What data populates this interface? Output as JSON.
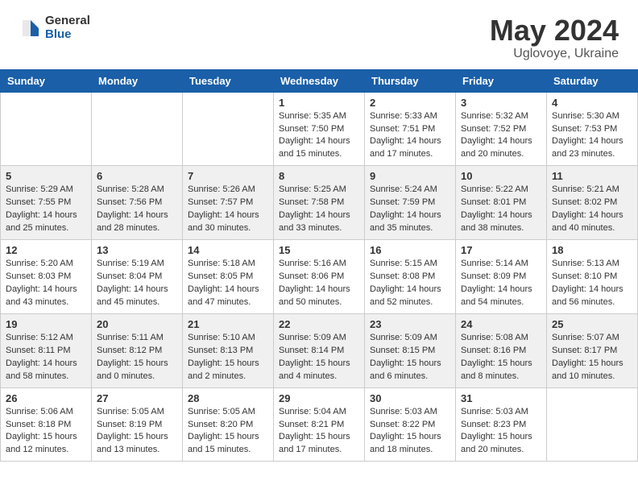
{
  "header": {
    "logo_general": "General",
    "logo_blue": "Blue",
    "month_year": "May 2024",
    "location": "Uglovoye, Ukraine"
  },
  "days_of_week": [
    "Sunday",
    "Monday",
    "Tuesday",
    "Wednesday",
    "Thursday",
    "Friday",
    "Saturday"
  ],
  "weeks": [
    [
      {
        "day": "",
        "info": ""
      },
      {
        "day": "",
        "info": ""
      },
      {
        "day": "",
        "info": ""
      },
      {
        "day": "1",
        "info": "Sunrise: 5:35 AM\nSunset: 7:50 PM\nDaylight: 14 hours\nand 15 minutes."
      },
      {
        "day": "2",
        "info": "Sunrise: 5:33 AM\nSunset: 7:51 PM\nDaylight: 14 hours\nand 17 minutes."
      },
      {
        "day": "3",
        "info": "Sunrise: 5:32 AM\nSunset: 7:52 PM\nDaylight: 14 hours\nand 20 minutes."
      },
      {
        "day": "4",
        "info": "Sunrise: 5:30 AM\nSunset: 7:53 PM\nDaylight: 14 hours\nand 23 minutes."
      }
    ],
    [
      {
        "day": "5",
        "info": "Sunrise: 5:29 AM\nSunset: 7:55 PM\nDaylight: 14 hours\nand 25 minutes."
      },
      {
        "day": "6",
        "info": "Sunrise: 5:28 AM\nSunset: 7:56 PM\nDaylight: 14 hours\nand 28 minutes."
      },
      {
        "day": "7",
        "info": "Sunrise: 5:26 AM\nSunset: 7:57 PM\nDaylight: 14 hours\nand 30 minutes."
      },
      {
        "day": "8",
        "info": "Sunrise: 5:25 AM\nSunset: 7:58 PM\nDaylight: 14 hours\nand 33 minutes."
      },
      {
        "day": "9",
        "info": "Sunrise: 5:24 AM\nSunset: 7:59 PM\nDaylight: 14 hours\nand 35 minutes."
      },
      {
        "day": "10",
        "info": "Sunrise: 5:22 AM\nSunset: 8:01 PM\nDaylight: 14 hours\nand 38 minutes."
      },
      {
        "day": "11",
        "info": "Sunrise: 5:21 AM\nSunset: 8:02 PM\nDaylight: 14 hours\nand 40 minutes."
      }
    ],
    [
      {
        "day": "12",
        "info": "Sunrise: 5:20 AM\nSunset: 8:03 PM\nDaylight: 14 hours\nand 43 minutes."
      },
      {
        "day": "13",
        "info": "Sunrise: 5:19 AM\nSunset: 8:04 PM\nDaylight: 14 hours\nand 45 minutes."
      },
      {
        "day": "14",
        "info": "Sunrise: 5:18 AM\nSunset: 8:05 PM\nDaylight: 14 hours\nand 47 minutes."
      },
      {
        "day": "15",
        "info": "Sunrise: 5:16 AM\nSunset: 8:06 PM\nDaylight: 14 hours\nand 50 minutes."
      },
      {
        "day": "16",
        "info": "Sunrise: 5:15 AM\nSunset: 8:08 PM\nDaylight: 14 hours\nand 52 minutes."
      },
      {
        "day": "17",
        "info": "Sunrise: 5:14 AM\nSunset: 8:09 PM\nDaylight: 14 hours\nand 54 minutes."
      },
      {
        "day": "18",
        "info": "Sunrise: 5:13 AM\nSunset: 8:10 PM\nDaylight: 14 hours\nand 56 minutes."
      }
    ],
    [
      {
        "day": "19",
        "info": "Sunrise: 5:12 AM\nSunset: 8:11 PM\nDaylight: 14 hours\nand 58 minutes."
      },
      {
        "day": "20",
        "info": "Sunrise: 5:11 AM\nSunset: 8:12 PM\nDaylight: 15 hours\nand 0 minutes."
      },
      {
        "day": "21",
        "info": "Sunrise: 5:10 AM\nSunset: 8:13 PM\nDaylight: 15 hours\nand 2 minutes."
      },
      {
        "day": "22",
        "info": "Sunrise: 5:09 AM\nSunset: 8:14 PM\nDaylight: 15 hours\nand 4 minutes."
      },
      {
        "day": "23",
        "info": "Sunrise: 5:09 AM\nSunset: 8:15 PM\nDaylight: 15 hours\nand 6 minutes."
      },
      {
        "day": "24",
        "info": "Sunrise: 5:08 AM\nSunset: 8:16 PM\nDaylight: 15 hours\nand 8 minutes."
      },
      {
        "day": "25",
        "info": "Sunrise: 5:07 AM\nSunset: 8:17 PM\nDaylight: 15 hours\nand 10 minutes."
      }
    ],
    [
      {
        "day": "26",
        "info": "Sunrise: 5:06 AM\nSunset: 8:18 PM\nDaylight: 15 hours\nand 12 minutes."
      },
      {
        "day": "27",
        "info": "Sunrise: 5:05 AM\nSunset: 8:19 PM\nDaylight: 15 hours\nand 13 minutes."
      },
      {
        "day": "28",
        "info": "Sunrise: 5:05 AM\nSunset: 8:20 PM\nDaylight: 15 hours\nand 15 minutes."
      },
      {
        "day": "29",
        "info": "Sunrise: 5:04 AM\nSunset: 8:21 PM\nDaylight: 15 hours\nand 17 minutes."
      },
      {
        "day": "30",
        "info": "Sunrise: 5:03 AM\nSunset: 8:22 PM\nDaylight: 15 hours\nand 18 minutes."
      },
      {
        "day": "31",
        "info": "Sunrise: 5:03 AM\nSunset: 8:23 PM\nDaylight: 15 hours\nand 20 minutes."
      },
      {
        "day": "",
        "info": ""
      }
    ]
  ]
}
